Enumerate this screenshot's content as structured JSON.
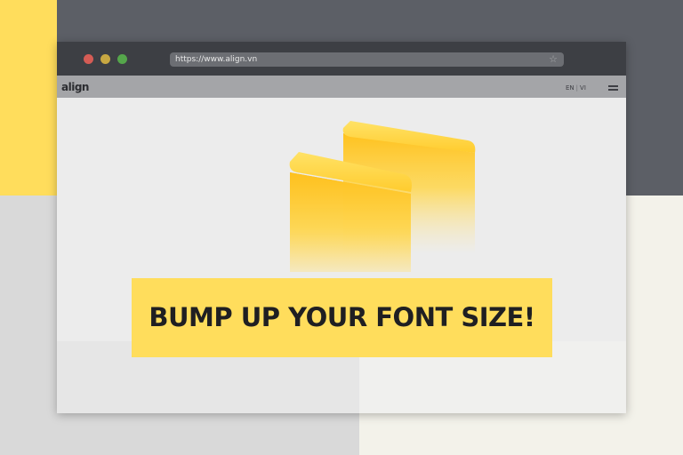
{
  "browser": {
    "window_controls": [
      "close",
      "minimize",
      "maximize"
    ],
    "url": "https://www.align.vn",
    "bookmark_icon": "star-icon"
  },
  "site_header": {
    "logo_text": "align",
    "languages": [
      "EN",
      "VI"
    ],
    "language_separator": "|",
    "menu_icon": "hamburger-menu-icon"
  },
  "hero": {
    "illustration": "yellow-3d-blocks",
    "banner_text": "BUMP UP YOUR FONT SIZE!"
  },
  "colors": {
    "accent_yellow": "#ffdd5c",
    "dark_gray": "#5c5f66",
    "titlebar": "#3d3f44",
    "site_header": "#a4a5a8"
  }
}
